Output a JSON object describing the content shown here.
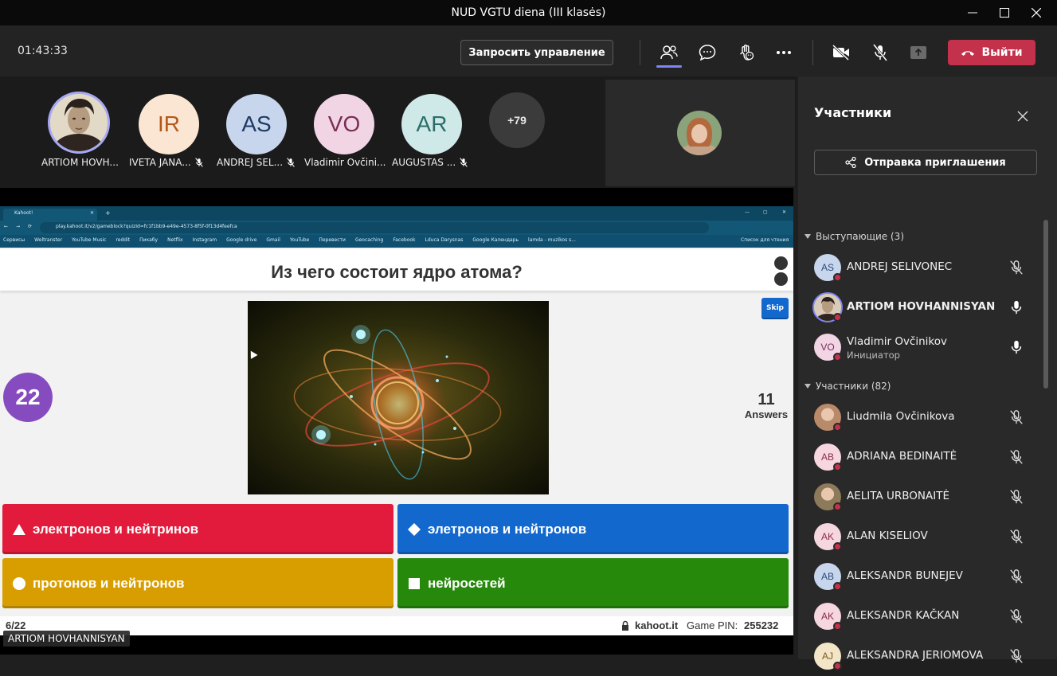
{
  "window": {
    "title": "NUD VGTU diena (III klasės)"
  },
  "toolbar": {
    "timer": "01:43:33",
    "request_control_label": "Запросить управление",
    "leave_label": "Выйти"
  },
  "gallery": {
    "tiles": [
      {
        "initials": "",
        "name": "ARTIOM HOVH...",
        "muted": false
      },
      {
        "initials": "IR",
        "name": "IVETA JANA...",
        "muted": true
      },
      {
        "initials": "AS",
        "name": "ANDREJ SEL...",
        "muted": true
      },
      {
        "initials": "VO",
        "name": "Vladimir Ovčini...",
        "muted": false
      },
      {
        "initials": "AR",
        "name": "AUGUSTAS ...",
        "muted": true
      }
    ],
    "overflow_label": "+79"
  },
  "browser": {
    "tab_title": "Kahoot!",
    "url": "play.kahoot.it/v2/gameblock?quizId=fc1f1bb9-e49e-4573-8f5f-0f13d4feefca",
    "bookmarks": [
      "Сервисы",
      "Weltranster",
      "YouTube Music",
      "reddit",
      "Пикабу",
      "Netflix",
      "Instagram",
      "Google drive",
      "Gmail",
      "YouTube",
      "Перевести",
      "Geocaching",
      "Facebook",
      "Lduca Darysnas",
      "Google Календарь",
      "lamda - muzikos s...",
      "Список для чтения"
    ]
  },
  "kahoot": {
    "question": "Из чего состоит ядро атома?",
    "timer": "22",
    "answers_count": "11",
    "answers_label": "Answers",
    "skip_label": "Skip",
    "answers": [
      {
        "text": "электронов и нейтринов",
        "shape": "triangle",
        "color": "#e21b3c"
      },
      {
        "text": "элетронов и нейтронов",
        "shape": "diamond",
        "color": "#1368ce"
      },
      {
        "text": "протонов и нейтронов",
        "shape": "circle",
        "color": "#d89e00"
      },
      {
        "text": "нейросетей",
        "shape": "square",
        "color": "#26890c"
      }
    ],
    "progress": "6/22",
    "site": "kahoot.it",
    "pin_label": "Game PIN:",
    "pin": "255232"
  },
  "presenter_caption": "ARTIOM HOVHANNISYAN",
  "participants_panel": {
    "title": "Участники",
    "invite_label": "Отправка приглашения",
    "presenters_section": "Выступающие (3)",
    "attendees_section": "Участники (82)",
    "presenters": [
      {
        "initials": "AS",
        "name": "ANDREJ SELIVONEC",
        "subtitle": "",
        "mic": "muted",
        "bold": false,
        "avatar_bg": "#c7d6ec",
        "avatar_fg": "#2b4a7a"
      },
      {
        "initials": "",
        "name": "ARTIOM HOVHANNISYAN",
        "subtitle": "",
        "mic": "on",
        "bold": true,
        "avatar_bg": "#7a6a58",
        "avatar_fg": "#fff"
      },
      {
        "initials": "VO",
        "name": "Vladimir Ovčinikov",
        "subtitle": "Инициатор",
        "mic": "on",
        "bold": false,
        "avatar_bg": "#f1d5e5",
        "avatar_fg": "#7a2d55"
      }
    ],
    "attendees": [
      {
        "initials": "",
        "name": "Liudmila Ovčinikova",
        "mic": "muted",
        "avatar_bg": "#b98a6a",
        "avatar_fg": "#fff"
      },
      {
        "initials": "AB",
        "name": "ADRIANA BEDINAITĖ",
        "mic": "muted",
        "avatar_bg": "#f6d6df",
        "avatar_fg": "#8a2d4a"
      },
      {
        "initials": "",
        "name": "AELITA URBONAITĖ",
        "mic": "muted",
        "avatar_bg": "#8c7a5a",
        "avatar_fg": "#fff"
      },
      {
        "initials": "AK",
        "name": "ALAN KISELIOV",
        "mic": "muted",
        "avatar_bg": "#f6d6df",
        "avatar_fg": "#8a2d4a"
      },
      {
        "initials": "AB",
        "name": "ALEKSANDR BUNEJEV",
        "mic": "muted",
        "avatar_bg": "#c7d6ec",
        "avatar_fg": "#2b4a7a"
      },
      {
        "initials": "AK",
        "name": "ALEKSANDR KAČKAN",
        "mic": "muted",
        "avatar_bg": "#f6d6df",
        "avatar_fg": "#8a2d4a"
      },
      {
        "initials": "AJ",
        "name": "ALEKSANDRA JERIOMOVA",
        "mic": "muted",
        "avatar_bg": "#f3e6c8",
        "avatar_fg": "#7a5a18"
      }
    ]
  }
}
